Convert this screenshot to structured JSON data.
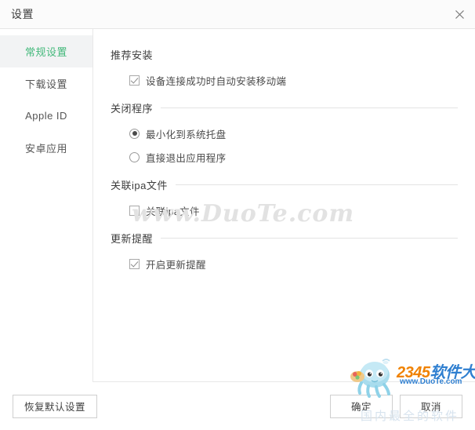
{
  "window": {
    "title": "设置",
    "close_icon": "close-icon"
  },
  "sidebar": {
    "items": [
      {
        "label": "常规设置",
        "active": true
      },
      {
        "label": "下载设置",
        "active": false
      },
      {
        "label": "Apple ID",
        "active": false
      },
      {
        "label": "安卓应用",
        "active": false
      }
    ]
  },
  "sections": [
    {
      "title": "推荐安装",
      "rule": false,
      "options": [
        {
          "type": "checkbox",
          "label": "设备连接成功时自动安装移动端",
          "checked": true
        }
      ]
    },
    {
      "title": "关闭程序",
      "rule": true,
      "options": [
        {
          "type": "radio",
          "label": "最小化到系统托盘",
          "checked": true
        },
        {
          "type": "radio",
          "label": "直接退出应用程序",
          "checked": false
        }
      ]
    },
    {
      "title": "关联ipa文件",
      "rule": true,
      "options": [
        {
          "type": "checkbox",
          "label": "关联ipa文件",
          "checked": false
        }
      ]
    },
    {
      "title": "更新提醒",
      "rule": true,
      "options": [
        {
          "type": "checkbox",
          "label": "开启更新提醒",
          "checked": true
        }
      ]
    }
  ],
  "footer": {
    "restore_label": "恢复默认设置",
    "ok_label": "确定",
    "cancel_label": "取消"
  },
  "watermarks": {
    "site_text": "www.DuoTe.com",
    "brand_number": "2345",
    "brand_name": "软件大全",
    "brand_url": "www.DuoTe.com",
    "faint_text": "国内最全的软件"
  },
  "colors": {
    "accent_green": "#45b97c",
    "title_text": "#3d3d3d",
    "border": "#e8e8e8",
    "brand_orange": "#f08200",
    "brand_blue": "#2f7fd0"
  }
}
